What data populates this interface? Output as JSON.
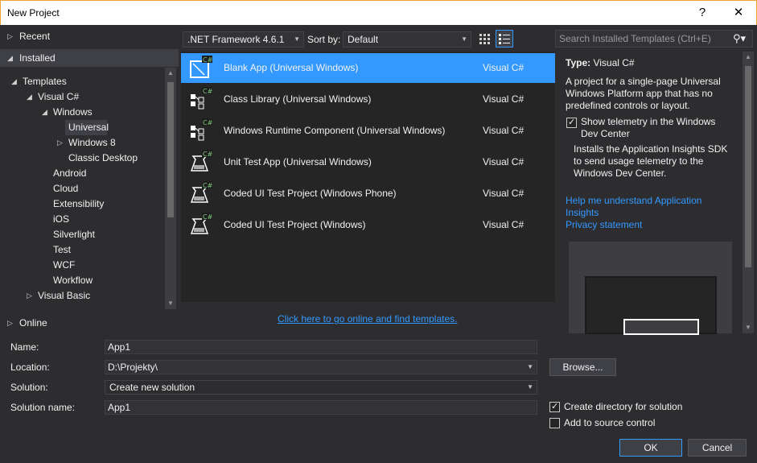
{
  "window": {
    "title": "New Project",
    "help_glyph": "?",
    "close_glyph": "✕"
  },
  "sidebar": {
    "recent": "Recent",
    "installed": "Installed",
    "online": "Online",
    "tree": [
      {
        "label": "Templates",
        "level": 0,
        "toggle": "expanded"
      },
      {
        "label": "Visual C#",
        "level": 1,
        "toggle": "expanded"
      },
      {
        "label": "Windows",
        "level": 2,
        "toggle": "expanded"
      },
      {
        "label": "Universal",
        "level": 3,
        "toggle": "none",
        "selected": true
      },
      {
        "label": "Windows 8",
        "level": 3,
        "toggle": "collapsed"
      },
      {
        "label": "Classic Desktop",
        "level": 3,
        "toggle": "none"
      },
      {
        "label": "Android",
        "level": 2,
        "toggle": "none"
      },
      {
        "label": "Cloud",
        "level": 2,
        "toggle": "none"
      },
      {
        "label": "Extensibility",
        "level": 2,
        "toggle": "none"
      },
      {
        "label": "iOS",
        "level": 2,
        "toggle": "none"
      },
      {
        "label": "Silverlight",
        "level": 2,
        "toggle": "none"
      },
      {
        "label": "Test",
        "level": 2,
        "toggle": "none"
      },
      {
        "label": "WCF",
        "level": 2,
        "toggle": "none"
      },
      {
        "label": "Workflow",
        "level": 2,
        "toggle": "none"
      },
      {
        "label": "Visual Basic",
        "level": 1,
        "toggle": "collapsed"
      }
    ]
  },
  "toolbar": {
    "framework": ".NET Framework 4.6.1",
    "sort_label": "Sort by:",
    "sort_value": "Default"
  },
  "search": {
    "placeholder": "Search Installed Templates (Ctrl+E)"
  },
  "templates": [
    {
      "name": "Blank App (Universal Windows)",
      "language": "Visual C#",
      "selected": true,
      "icon": "blank-app-icon"
    },
    {
      "name": "Class Library (Universal Windows)",
      "language": "Visual C#",
      "icon": "class-library-icon"
    },
    {
      "name": "Windows Runtime Component (Universal Windows)",
      "language": "Visual C#",
      "icon": "runtime-component-icon"
    },
    {
      "name": "Unit Test App (Universal Windows)",
      "language": "Visual C#",
      "icon": "unit-test-icon"
    },
    {
      "name": "Coded UI Test Project (Windows Phone)",
      "language": "Visual C#",
      "icon": "coded-ui-test-icon"
    },
    {
      "name": "Coded UI Test Project (Windows)",
      "language": "Visual C#",
      "icon": "coded-ui-test-icon"
    }
  ],
  "online_link": "Click here to go online and find templates.",
  "details": {
    "type_label": "Type:",
    "type_value": "Visual C#",
    "description": "A project for a single-page Universal Windows Platform app that has no predefined controls or layout.",
    "telemetry_checkbox": "Show telemetry in the Windows Dev Center",
    "telemetry_checked": true,
    "telemetry_desc": "Installs the Application Insights SDK to send usage telemetry to the Windows Dev Center.",
    "help_link": "Help me understand Application Insights",
    "privacy_link": "Privacy statement"
  },
  "form": {
    "name_label": "Name:",
    "name_value": "App1",
    "location_label": "Location:",
    "location_value": "D:\\Projekty\\",
    "solution_label": "Solution:",
    "solution_value": "Create new solution",
    "solution_name_label": "Solution name:",
    "solution_name_value": "App1",
    "browse_button": "Browse...",
    "create_dir_label": "Create directory for solution",
    "create_dir_checked": true,
    "source_control_label": "Add to source control",
    "source_control_checked": false,
    "ok_button": "OK",
    "cancel_button": "Cancel"
  },
  "colors": {
    "accent": "#3399ff",
    "background": "#2d2d30",
    "list_background": "#252526",
    "window_border": "#f0a030"
  }
}
